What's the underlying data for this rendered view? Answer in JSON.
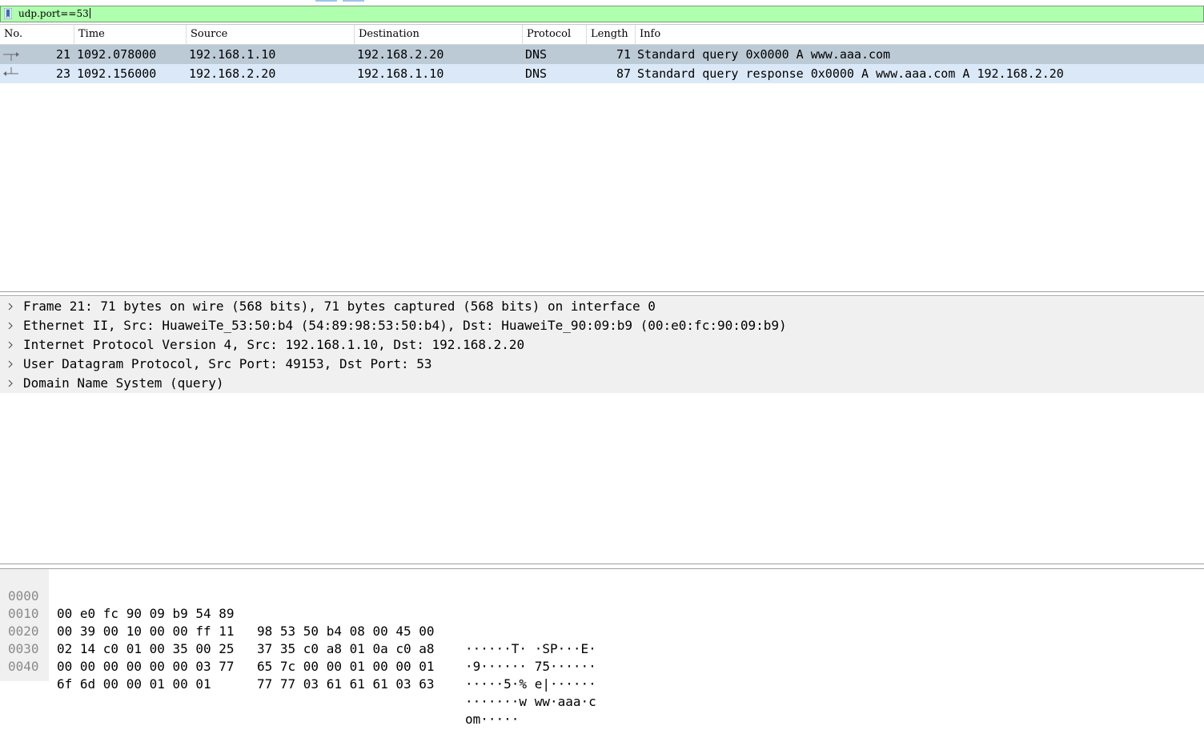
{
  "filter": {
    "text": "udp.port==53"
  },
  "columns": [
    "No.",
    "Time",
    "Source",
    "Destination",
    "Protocol",
    "Length",
    "Info"
  ],
  "packets": [
    {
      "no": "21",
      "time": "1092.078000",
      "source": "192.168.1.10",
      "destination": "192.168.2.20",
      "protocol": "DNS",
      "length": "71",
      "info": "Standard query 0x0000 A www.aaa.com",
      "related_icon": "request-arrow-icon"
    },
    {
      "no": "23",
      "time": "1092.156000",
      "source": "192.168.2.20",
      "destination": "192.168.1.10",
      "protocol": "DNS",
      "length": "87",
      "info": "Standard query response 0x0000 A www.aaa.com A 192.168.2.20",
      "related_icon": "response-arrow-icon"
    }
  ],
  "details": [
    "Frame 21: 71 bytes on wire (568 bits), 71 bytes captured (568 bits) on interface 0",
    "Ethernet II, Src: HuaweiTe_53:50:b4 (54:89:98:53:50:b4), Dst: HuaweiTe_90:09:b9 (00:e0:fc:90:09:b9)",
    "Internet Protocol Version 4, Src: 192.168.1.10, Dst: 192.168.2.20",
    "User Datagram Protocol, Src Port: 49153, Dst Port: 53",
    "Domain Name System (query)"
  ],
  "bytes": [
    {
      "offset": "0000",
      "hex1": "00 e0 fc 90 09 b9 54 89",
      "hex2": "98 53 50 b4 08 00 45 00",
      "ascii": "······T· ·SP···E·"
    },
    {
      "offset": "0010",
      "hex1": "00 39 00 10 00 00 ff 11",
      "hex2": "37 35 c0 a8 01 0a c0 a8",
      "ascii": "·9······ 75······"
    },
    {
      "offset": "0020",
      "hex1": "02 14 c0 01 00 35 00 25",
      "hex2": "65 7c 00 00 01 00 00 01",
      "ascii": "·····5·% e|······"
    },
    {
      "offset": "0030",
      "hex1": "00 00 00 00 00 00 03 77",
      "hex2": "77 77 03 61 61 61 03 63",
      "ascii": "·······w ww·aaa·c"
    },
    {
      "offset": "0040",
      "hex1": "6f 6d 00 00 01 00 01",
      "hex2": "",
      "ascii": "om·····"
    }
  ],
  "colors": {
    "filter_valid_bg": "#afffaf",
    "selected_row_bg": "#bccad6",
    "related_row_bg": "#dbe8f8",
    "details_row_bg": "#f0f0f0"
  }
}
